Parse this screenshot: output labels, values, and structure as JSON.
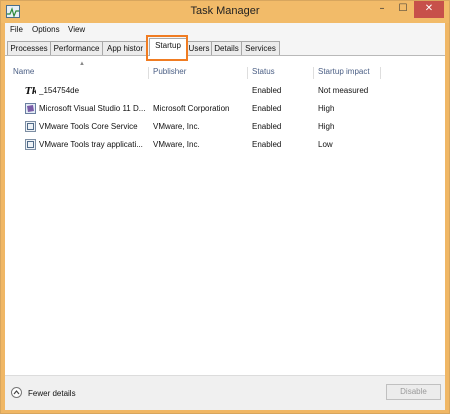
{
  "window": {
    "title": "Task Manager",
    "accent": "#f2bb69",
    "close_color": "#c7504a",
    "controls": {
      "minimize": "–",
      "maximize": "☐",
      "close": "✕"
    }
  },
  "menu": [
    "File",
    "Options",
    "View"
  ],
  "tabs": [
    {
      "label": "Processes",
      "active": false
    },
    {
      "label": "Performance",
      "active": false
    },
    {
      "label": "App histor",
      "active": false
    },
    {
      "label": "Startup",
      "active": true
    },
    {
      "label": "Users",
      "active": false
    },
    {
      "label": "Details",
      "active": false
    },
    {
      "label": "Services",
      "active": false
    }
  ],
  "highlight_color": "#f07c22",
  "columns": [
    "Name",
    "Publisher",
    "Status",
    "Startup impact"
  ],
  "rows": [
    {
      "icon": "tk-app-icon",
      "name": "_154754de",
      "publisher": "",
      "status": "Enabled",
      "impact": "Not measured"
    },
    {
      "icon": "visual-studio-icon",
      "name": "Microsoft Visual Studio 11 D...",
      "publisher": "Microsoft Corporation",
      "status": "Enabled",
      "impact": "High"
    },
    {
      "icon": "vmware-icon",
      "name": "VMware Tools Core Service",
      "publisher": "VMware, Inc.",
      "status": "Enabled",
      "impact": "High"
    },
    {
      "icon": "vmware-icon",
      "name": "VMware Tools tray applicati...",
      "publisher": "VMware, Inc.",
      "status": "Enabled",
      "impact": "Low"
    }
  ],
  "footer": {
    "fewer_details": "Fewer details",
    "disable": "Disable"
  }
}
